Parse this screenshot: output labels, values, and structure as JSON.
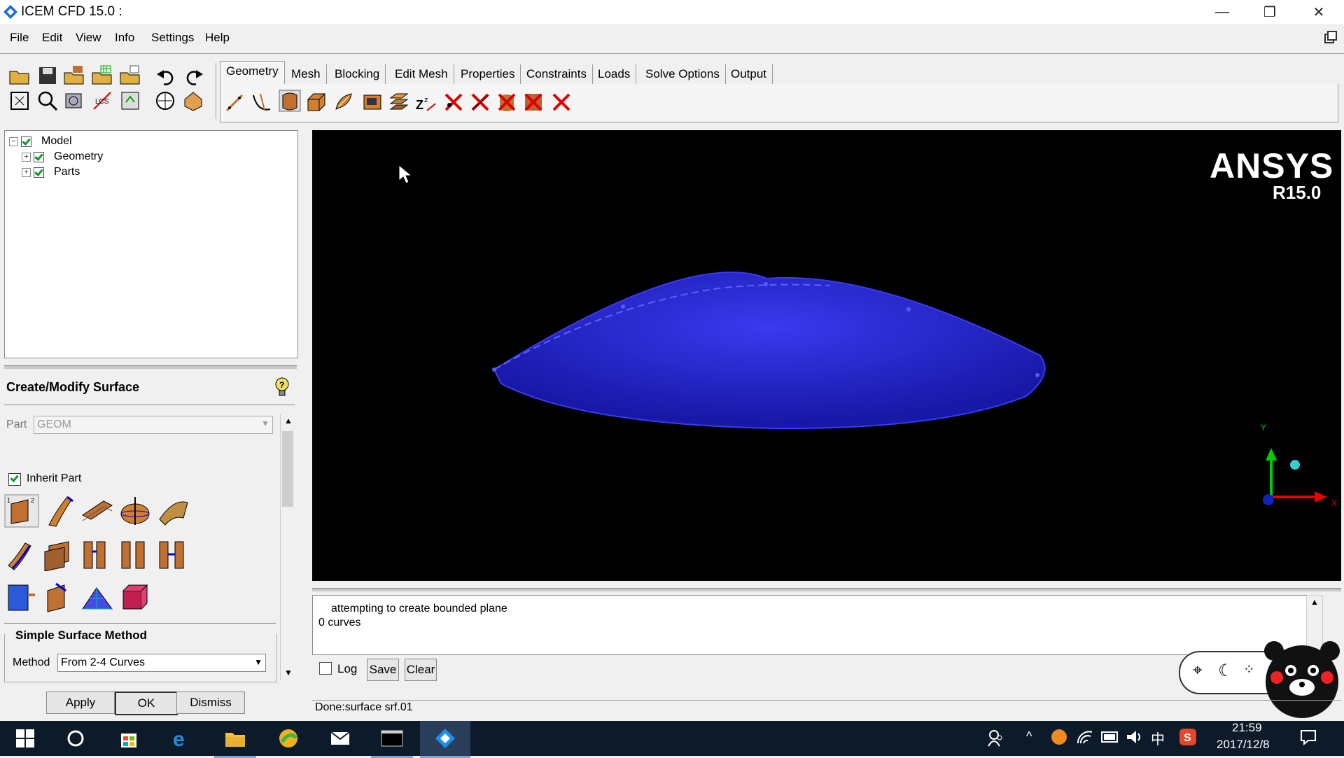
{
  "window": {
    "title": "ICEM CFD 15.0 :",
    "minimize": "—",
    "restore": "❐",
    "close": "✕"
  },
  "menu": [
    "File",
    "Edit",
    "View",
    "Info",
    "Settings",
    "Help"
  ],
  "tabs": [
    "Geometry",
    "Mesh",
    "Blocking",
    "Edit Mesh",
    "Properties",
    "Constraints",
    "Loads",
    "Solve Options",
    "Output"
  ],
  "tree": {
    "root": "Model",
    "children": [
      "Geometry",
      "Parts"
    ]
  },
  "panel": {
    "title": "Create/Modify Surface",
    "part_label": "Part",
    "part_value": "GEOM",
    "inherit_label": "Inherit Part",
    "method_section": "Simple Surface Method",
    "method_label": "Method",
    "method_value": "From 2-4 Curves",
    "apply": "Apply",
    "ok": "OK",
    "dismiss": "Dismiss"
  },
  "viewport": {
    "brand": "ANSYS",
    "version": "R15.0",
    "axis_y": "Y",
    "axis_x": "X",
    "shape_color": "#2a2ad8"
  },
  "messages": {
    "line1": "attempting to create bounded plane",
    "line2": "0 curves",
    "log_label": "Log",
    "save": "Save",
    "clear": "Clear"
  },
  "status": "Done:surface srf.01",
  "taskbar": {
    "time": "21:59",
    "date": "2017/12/8",
    "ime": "中"
  }
}
